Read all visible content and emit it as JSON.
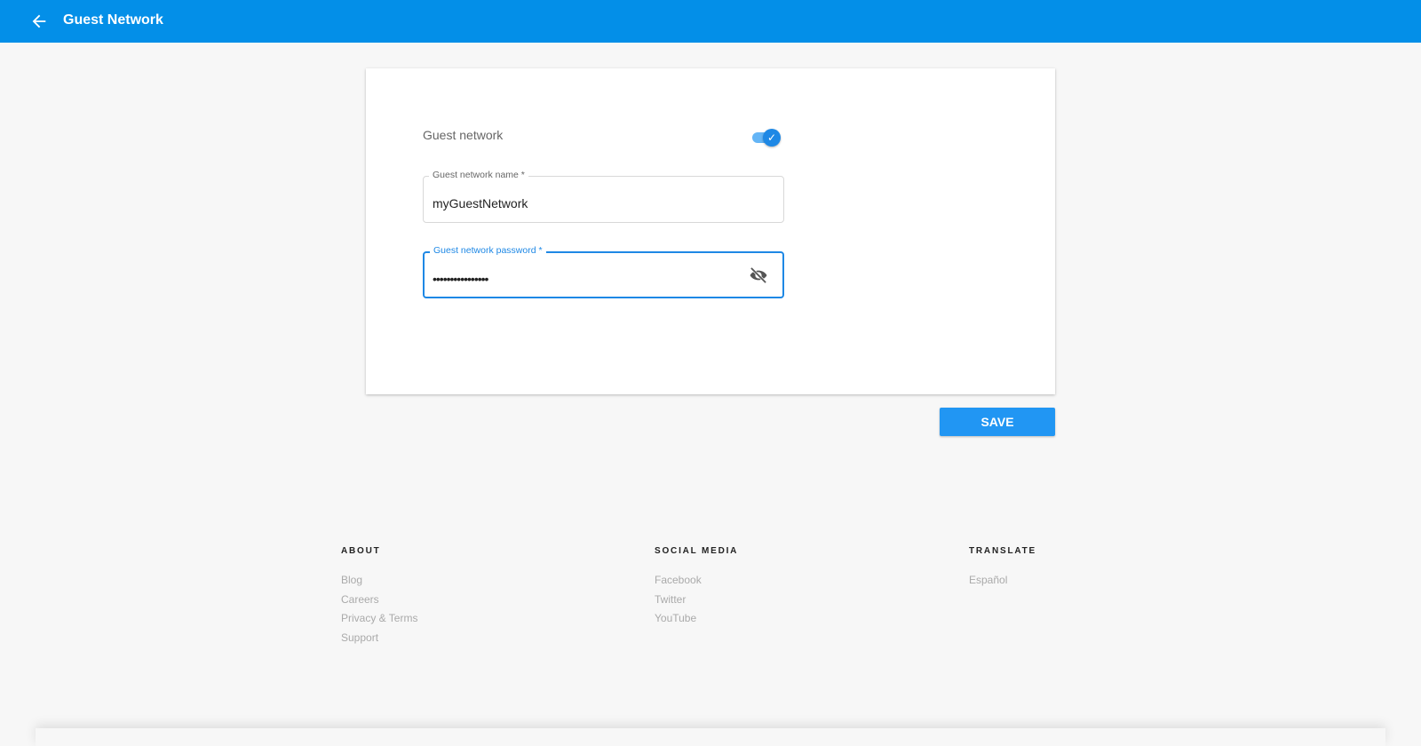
{
  "header": {
    "title": "Guest Network",
    "back_icon": "arrow-left-icon"
  },
  "card": {
    "toggle_label": "Guest network",
    "toggle_on": true,
    "name_field": {
      "label": "Guest network name *",
      "value": "myGuestNetwork"
    },
    "password_field": {
      "label": "Guest network password *",
      "value": "••••••••••••••••"
    }
  },
  "save_label": "SAVE",
  "footer": {
    "about": {
      "title": "ABOUT",
      "links": [
        "Blog",
        "Careers",
        "Privacy & Terms",
        "Support"
      ]
    },
    "social": {
      "title": "SOCIAL MEDIA",
      "links": [
        "Facebook",
        "Twitter",
        "YouTube"
      ]
    },
    "translate": {
      "title": "TRANSLATE",
      "links": [
        "Español"
      ]
    }
  },
  "colors": {
    "primary": "#038fe8",
    "accent": "#1e88e5"
  }
}
